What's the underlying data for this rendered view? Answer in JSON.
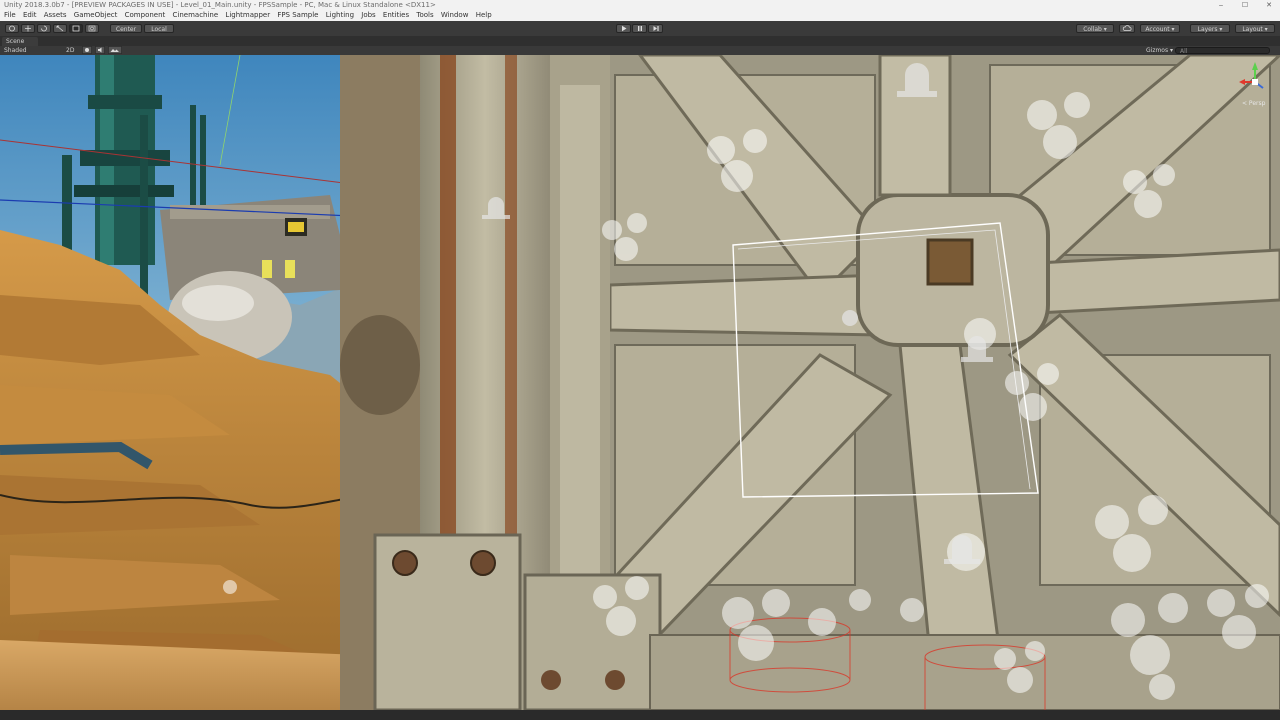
{
  "window": {
    "title": "Unity 2018.3.0b7 - [PREVIEW PACKAGES IN USE] - Level_01_Main.unity - FPSSample - PC, Mac & Linux Standalone <DX11>",
    "controls": [
      "‒",
      "☐",
      "✕"
    ]
  },
  "menu": [
    "File",
    "Edit",
    "Assets",
    "GameObject",
    "Component",
    "Cinemachine",
    "Lightmapper",
    "FPS Sample",
    "Lighting",
    "Jobs",
    "Entities",
    "Tools",
    "Window",
    "Help"
  ],
  "toolbar": {
    "pivot_label": "Center",
    "space_label": "Local",
    "collab_label": "Collab ▾",
    "account_label": "Account ▾",
    "layers_label": "Layers ▾",
    "layout_label": "Layout ▾",
    "cloud_icon": "cloud-icon",
    "play_icon": "play-icon",
    "pause_icon": "pause-icon",
    "step_icon": "step-icon"
  },
  "scene": {
    "tab_label": "Scene",
    "shading_mode": "Shaded",
    "mode_2d": "2D",
    "gizmos_label": "Gizmos ▾",
    "search_placeholder": "All",
    "gizmo_label": "< Persp"
  },
  "colors": {
    "toolbar_bg": "#3a3a3a",
    "menubar_bg": "#f2f2f2",
    "sky": "#4b8fbf",
    "rock": "#c8903f",
    "metal": "#b9b39c",
    "rust": "#8a4a22"
  }
}
